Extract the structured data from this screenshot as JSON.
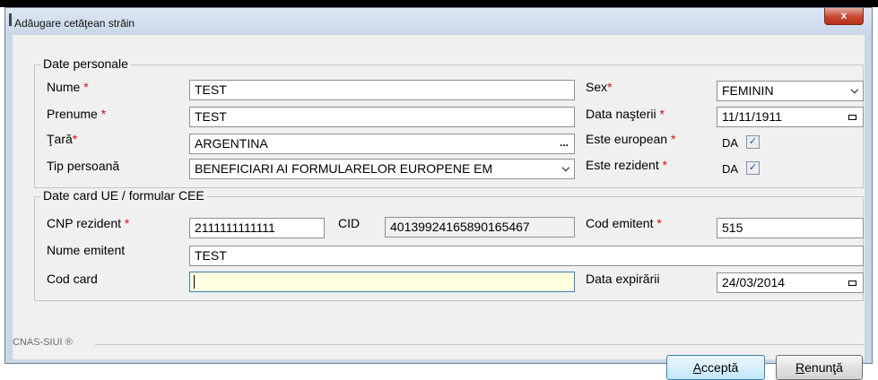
{
  "window": {
    "title": "Adăugare cetăţean străin",
    "close_label": "x"
  },
  "personal": {
    "legend": "Date personale",
    "nume": {
      "label": "Nume",
      "value": "TEST"
    },
    "prenume": {
      "label": "Prenume",
      "value": "TEST"
    },
    "tara": {
      "label": "Ţară",
      "value": "ARGENTINA",
      "button": "..."
    },
    "tip_persoana": {
      "label": "Tip persoană",
      "value": "BENEFICIARI AI FORMULARELOR EUROPENE EM"
    },
    "sex": {
      "label": "Sex",
      "value": "FEMININ"
    },
    "data_nasterii": {
      "label": "Data naşterii",
      "value": "11/11/1911"
    },
    "este_european": {
      "label": "Este european",
      "value": "DA",
      "checked": true
    },
    "este_rezident": {
      "label": "Este rezident",
      "value": "DA",
      "checked": true
    }
  },
  "card": {
    "legend": "Date card UE / formular CEE",
    "cnp": {
      "label": "CNP rezident",
      "value": "2111111111111"
    },
    "cid": {
      "label": "CID",
      "value": "40139924165890165467"
    },
    "cod_emitent": {
      "label": "Cod emitent",
      "value": "515"
    },
    "nume_emitent": {
      "label": "Nume emitent",
      "value": "TEST"
    },
    "cod_card": {
      "label": "Cod card",
      "value": ""
    },
    "data_expirarii": {
      "label": "Data expirării",
      "value": "24/03/2014"
    }
  },
  "required_mark": "*",
  "footer": {
    "text": "CNAS-SIUI ®"
  },
  "buttons": {
    "accept": {
      "mnemonic": "A",
      "rest": "cceptă"
    },
    "cancel": {
      "mnemonic": "R",
      "rest": "enunţă"
    }
  },
  "colors": {
    "required": "#d01010",
    "active_field": "#ffffe0",
    "close_button": "#c8452f"
  },
  "icons": {
    "dropdown": "chevron-down-icon",
    "calendar": "calendar-icon",
    "checkbox": "checkmark-icon"
  }
}
